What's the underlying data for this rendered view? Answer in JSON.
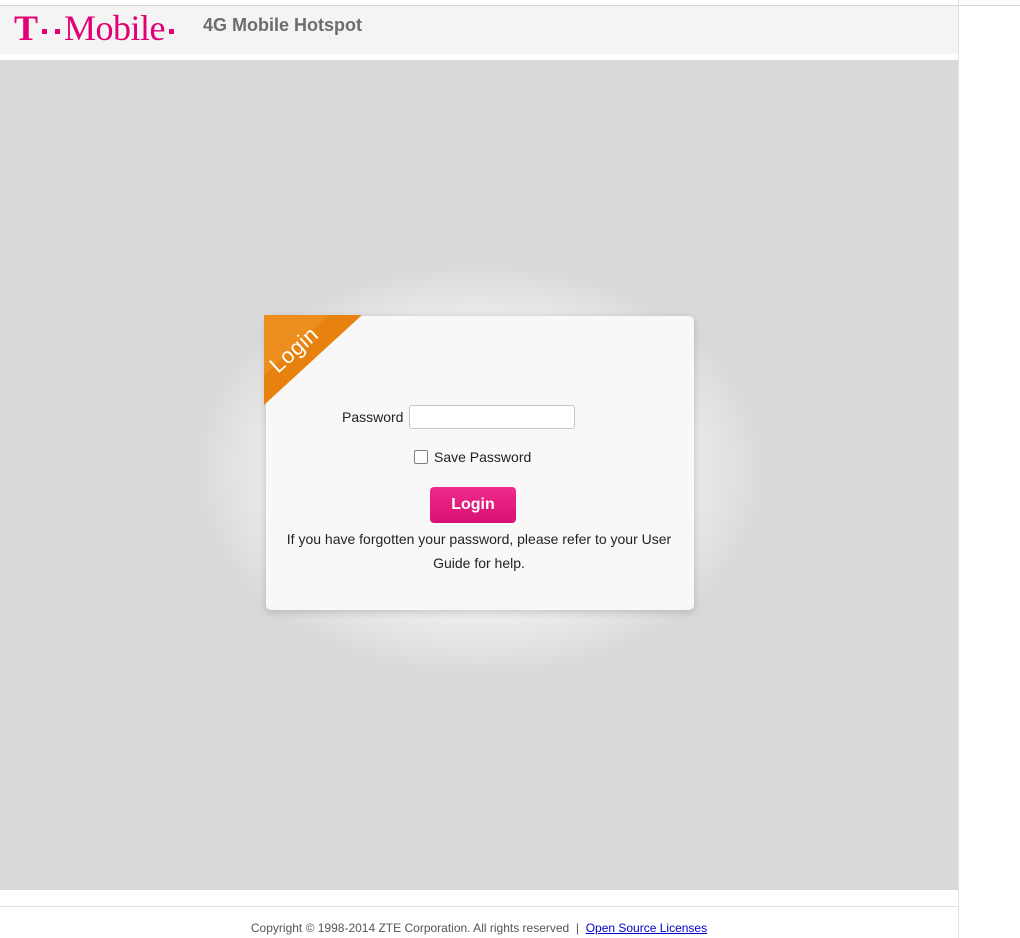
{
  "header": {
    "brand_t": "T",
    "brand_word": "Mobile",
    "product_name": "4G Mobile Hotspot"
  },
  "login_card": {
    "ribbon_label": "Login",
    "password_label": "Password",
    "password_value": "",
    "save_password_label": "Save Password",
    "save_password_checked": false,
    "login_button": "Login",
    "help_text": "If you have forgotten your password, please refer to your User Guide for help."
  },
  "footer": {
    "copyright": "Copyright © 1998-2014 ZTE Corporation. All rights reserved",
    "separator": "|",
    "open_source_link": "Open Source Licenses"
  },
  "colors": {
    "brand_magenta": "#e20074",
    "ribbon_orange": "#e8820f",
    "stage_gray": "#d9d9d9"
  },
  "icons": {
    "save_password_checkbox": "checkbox-icon"
  }
}
